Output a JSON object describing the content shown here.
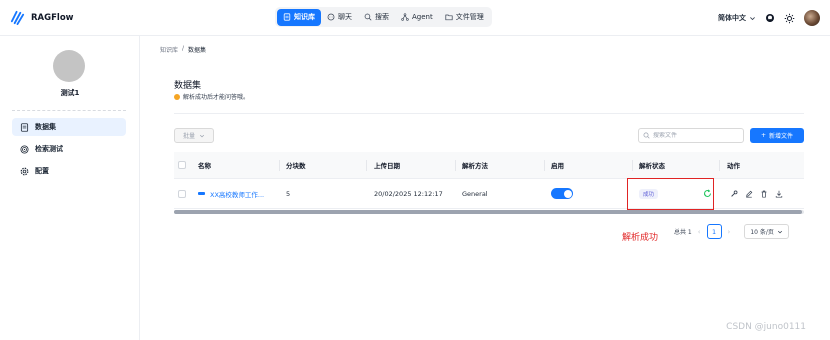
{
  "app": {
    "name": "RAGFlow"
  },
  "nav": {
    "items": [
      {
        "label": "知识库",
        "icon": "database-icon",
        "active": true
      },
      {
        "label": "聊天",
        "icon": "chat-icon",
        "active": false
      },
      {
        "label": "搜索",
        "icon": "search-icon",
        "active": false
      },
      {
        "label": "Agent",
        "icon": "agent-icon",
        "active": false
      },
      {
        "label": "文件管理",
        "icon": "folder-icon",
        "active": false
      }
    ]
  },
  "header": {
    "language": "简体中文"
  },
  "sidebar": {
    "kb_name": "测试1",
    "items": [
      {
        "label": "数据集",
        "icon": "document-icon",
        "active": true
      },
      {
        "label": "检索测试",
        "icon": "target-icon",
        "active": false
      },
      {
        "label": "配置",
        "icon": "gear-icon",
        "active": false
      }
    ]
  },
  "breadcrumb": {
    "root": "知识库",
    "separator": "/",
    "current": "数据集"
  },
  "main": {
    "title": "数据集",
    "subtitle": "解析成功后才能问答哦。",
    "batch_label": "批量",
    "search_placeholder": "搜索文件",
    "add_button": "新增文件"
  },
  "table": {
    "headers": {
      "name": "名称",
      "chunks": "分块数",
      "upload_date": "上传日期",
      "parse_method": "解析方法",
      "enabled": "启用",
      "parse_status": "解析状态",
      "actions": "动作"
    },
    "rows": [
      {
        "name": "XX高校教师工作...",
        "chunks": "5",
        "upload_date": "20/02/2025 12:12:17",
        "parse_method": "General",
        "enabled": true,
        "parse_status": "成功"
      }
    ]
  },
  "annotation": {
    "text": "解析成功"
  },
  "pagination": {
    "total": "总共 1",
    "current_page": "1",
    "page_size": "10 条/页"
  },
  "watermark": "CSDN @juno0111",
  "colors": {
    "accent": "#1677ff",
    "annotation": "#e02424",
    "status_badge_text": "#5b5bd6"
  }
}
